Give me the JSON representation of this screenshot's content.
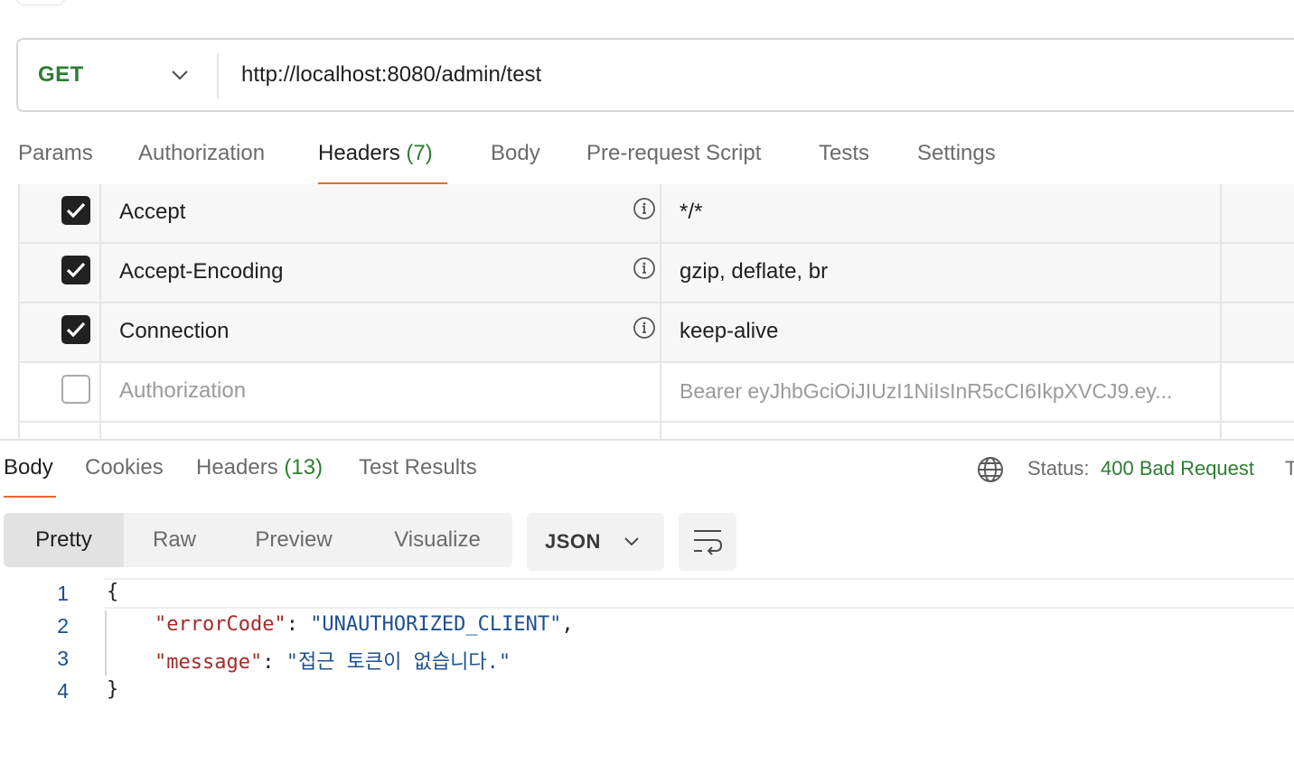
{
  "request": {
    "method": "GET",
    "url": "http://localhost:8080/admin/test"
  },
  "request_tabs": [
    {
      "label": "Params"
    },
    {
      "label": "Authorization"
    },
    {
      "label": "Headers",
      "count": "(7)"
    },
    {
      "label": "Body"
    },
    {
      "label": "Pre-request Script"
    },
    {
      "label": "Tests"
    },
    {
      "label": "Settings"
    }
  ],
  "headers": [
    {
      "checked": true,
      "key": "Accept",
      "value": "*/*"
    },
    {
      "checked": true,
      "key": "Accept-Encoding",
      "value": "gzip, deflate, br"
    },
    {
      "checked": true,
      "key": "Connection",
      "value": "keep-alive"
    },
    {
      "checked": false,
      "key": "Authorization",
      "value": "Bearer eyJhbGciOiJIUzI1NiIsInR5cCI6IkpXVCJ9.ey..."
    }
  ],
  "response_tabs": [
    {
      "label": "Body"
    },
    {
      "label": "Cookies"
    },
    {
      "label": "Headers",
      "count": "(13)"
    },
    {
      "label": "Test Results"
    }
  ],
  "status": {
    "label": "Status:",
    "value": "400 Bad Request",
    "trailing": "T"
  },
  "view_modes": [
    "Pretty",
    "Raw",
    "Preview",
    "Visualize"
  ],
  "format": "JSON",
  "code_lines": [
    {
      "num": "1"
    },
    {
      "num": "2",
      "key": "\"errorCode\"",
      "value": "\"UNAUTHORIZED_CLIENT\""
    },
    {
      "num": "3",
      "key": "\"message\"",
      "value": "\"접근 토큰이 없습니다.\""
    },
    {
      "num": "4"
    }
  ],
  "colors": {
    "accent": "#e8672f",
    "success": "#2e7d32",
    "json_key": "#a52a2a",
    "json_string": "#1d4f91"
  }
}
